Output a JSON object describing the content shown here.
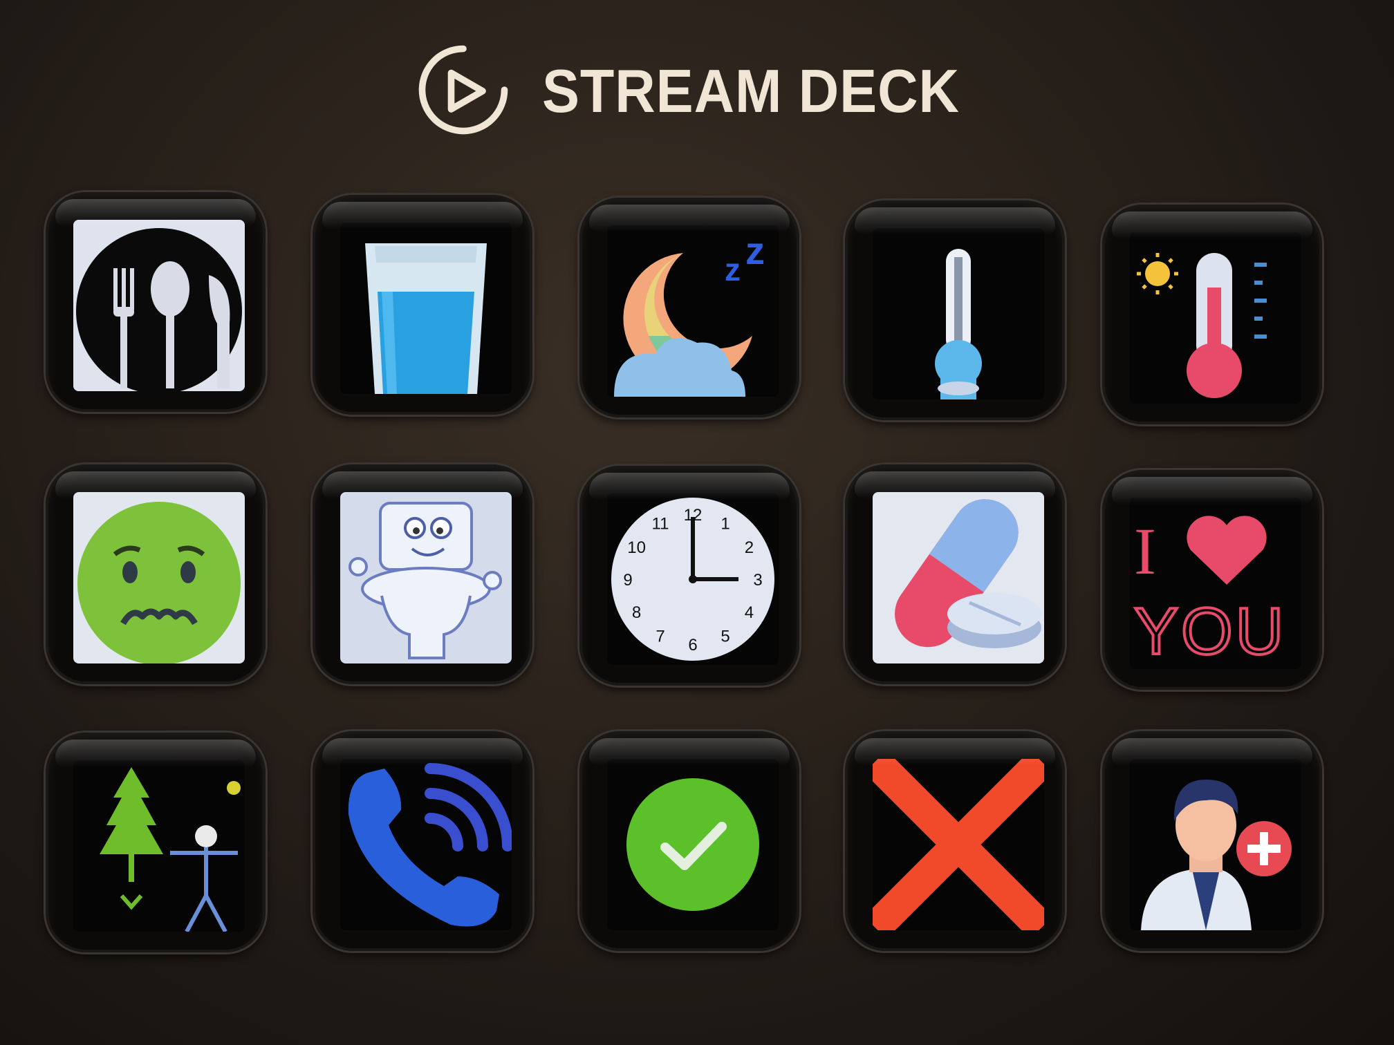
{
  "brand": {
    "name": "STREAM DECK",
    "logo_icon": "elgato-logo-icon",
    "text_color": "#f1e6d6"
  },
  "device": {
    "body_color": "#241d17",
    "key_rows": 3,
    "key_cols": 5
  },
  "keys": [
    {
      "icon": "plate-fork-spoon-knife-icon",
      "meaning": "eat"
    },
    {
      "icon": "glass-of-water-icon",
      "meaning": "drink"
    },
    {
      "icon": "moon-sleep-icon",
      "meaning": "sleep"
    },
    {
      "icon": "cold-thermometer-icon",
      "meaning": "cold"
    },
    {
      "icon": "hot-thermometer-icon",
      "meaning": "hot"
    },
    {
      "icon": "nauseous-face-icon",
      "meaning": "sick"
    },
    {
      "icon": "toilet-icon",
      "meaning": "bathroom"
    },
    {
      "icon": "clock-icon",
      "meaning": "time"
    },
    {
      "icon": "pills-icon",
      "meaning": "medicine"
    },
    {
      "icon": "i-love-you-icon",
      "meaning": "love",
      "text_top": "I",
      "text_bottom": "YOU"
    },
    {
      "icon": "tree-and-person-icon",
      "meaning": "outside"
    },
    {
      "icon": "phone-call-icon",
      "meaning": "call"
    },
    {
      "icon": "check-icon",
      "meaning": "yes"
    },
    {
      "icon": "x-mark-icon",
      "meaning": "no"
    },
    {
      "icon": "doctor-icon",
      "meaning": "doctor"
    }
  ],
  "clock": {
    "numbers": [
      "12",
      "1",
      "2",
      "3",
      "4",
      "5",
      "6",
      "7",
      "8",
      "9",
      "10",
      "11"
    ],
    "time_shown": "3:00"
  }
}
